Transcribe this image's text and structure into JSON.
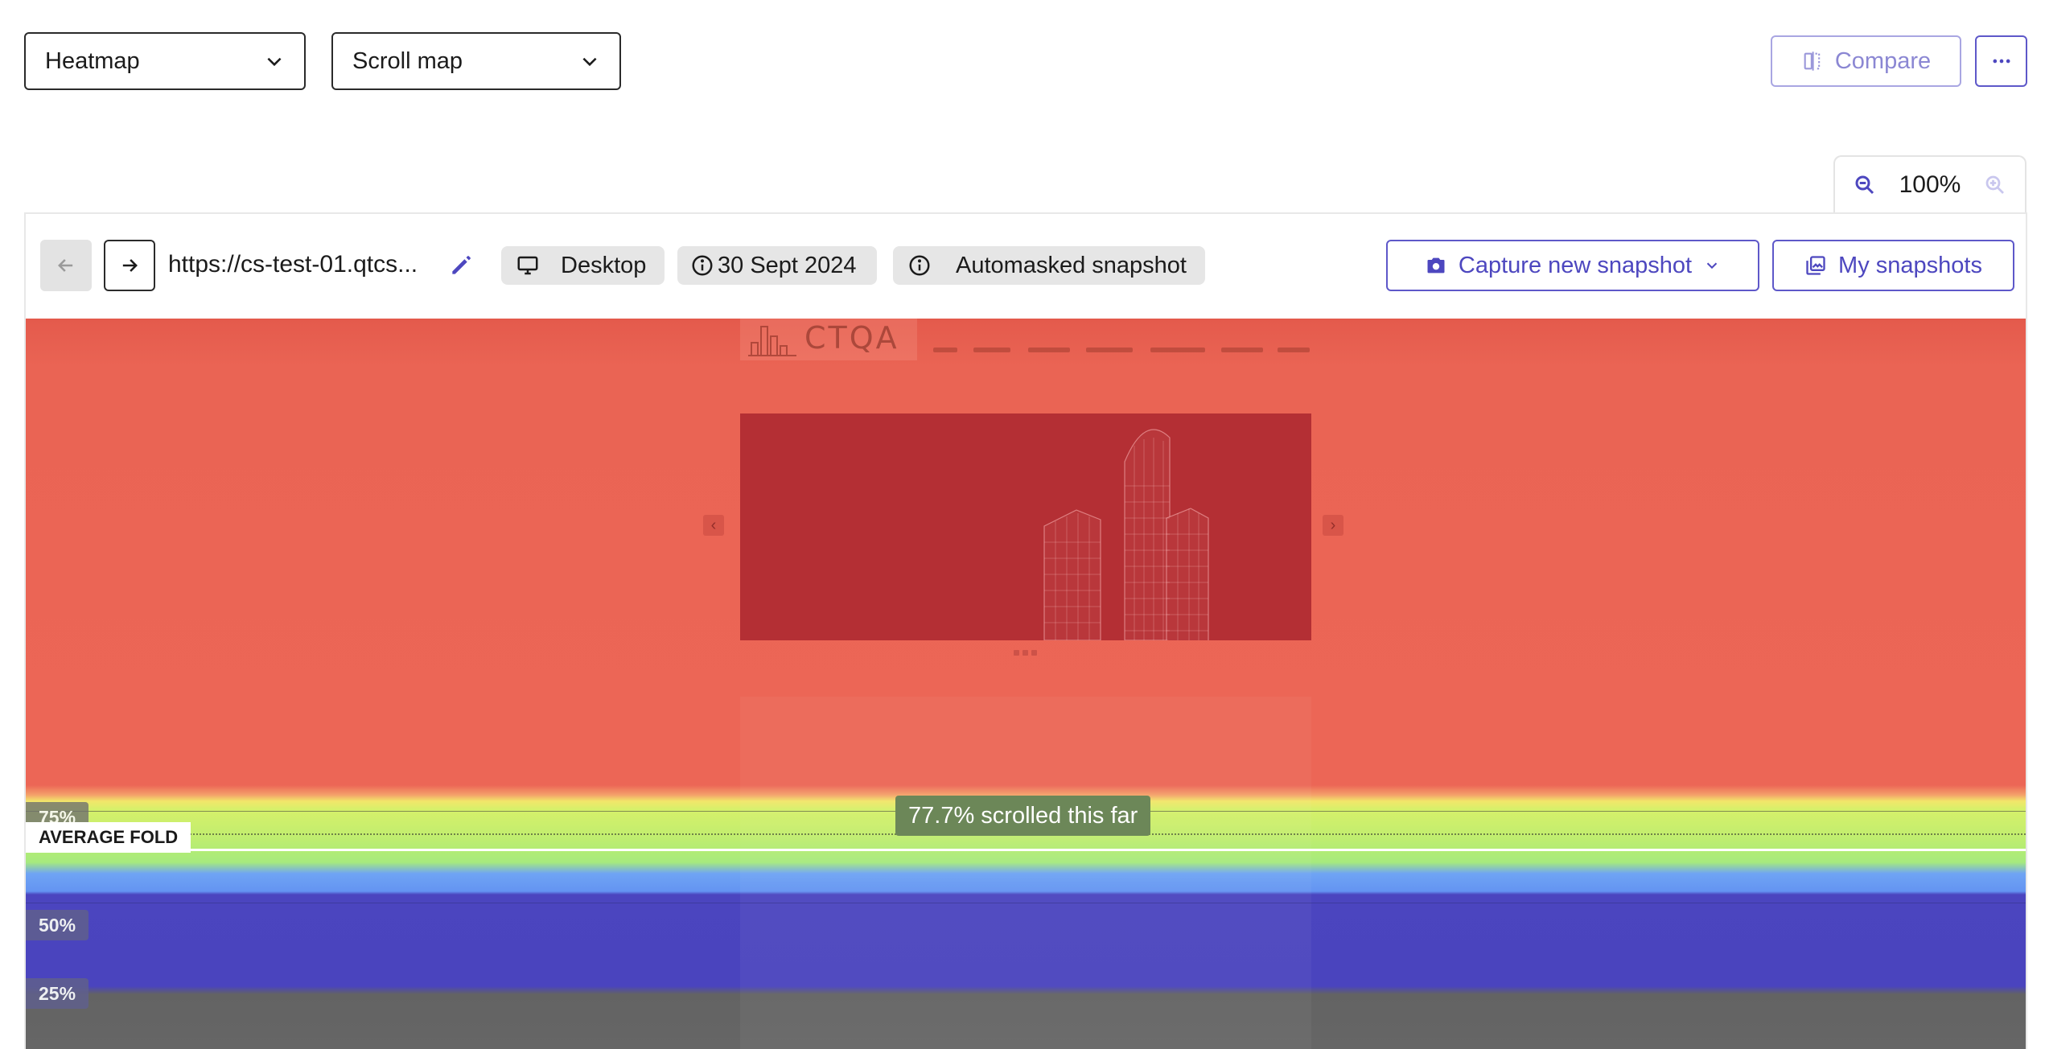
{
  "filters": {
    "type_select": "Heatmap",
    "mode_select": "Scroll map"
  },
  "actions": {
    "compare_label": "Compare"
  },
  "zoom": {
    "level": "100%"
  },
  "toolbar": {
    "url": "https://cs-test-01.qtcs...",
    "device": "Desktop",
    "date": "30 Sept 2024",
    "snapshot_type": "Automasked snapshot",
    "capture_label": "Capture new snapshot",
    "snapshots_label": "My snapshots"
  },
  "heatmap": {
    "site_logo": "CTQA",
    "labels": {
      "pct_75": "75%",
      "average_fold": "AVERAGE FOLD",
      "pct_50": "50%",
      "pct_25": "25%"
    },
    "tooltip": "77.7% scrolled this far",
    "colors": {
      "hot": "#ec6656",
      "warm": "#c4ee6e",
      "cool": "#6494f2",
      "cold": "#4a44be",
      "none": "#666666",
      "accent": "#5e58c9"
    }
  }
}
